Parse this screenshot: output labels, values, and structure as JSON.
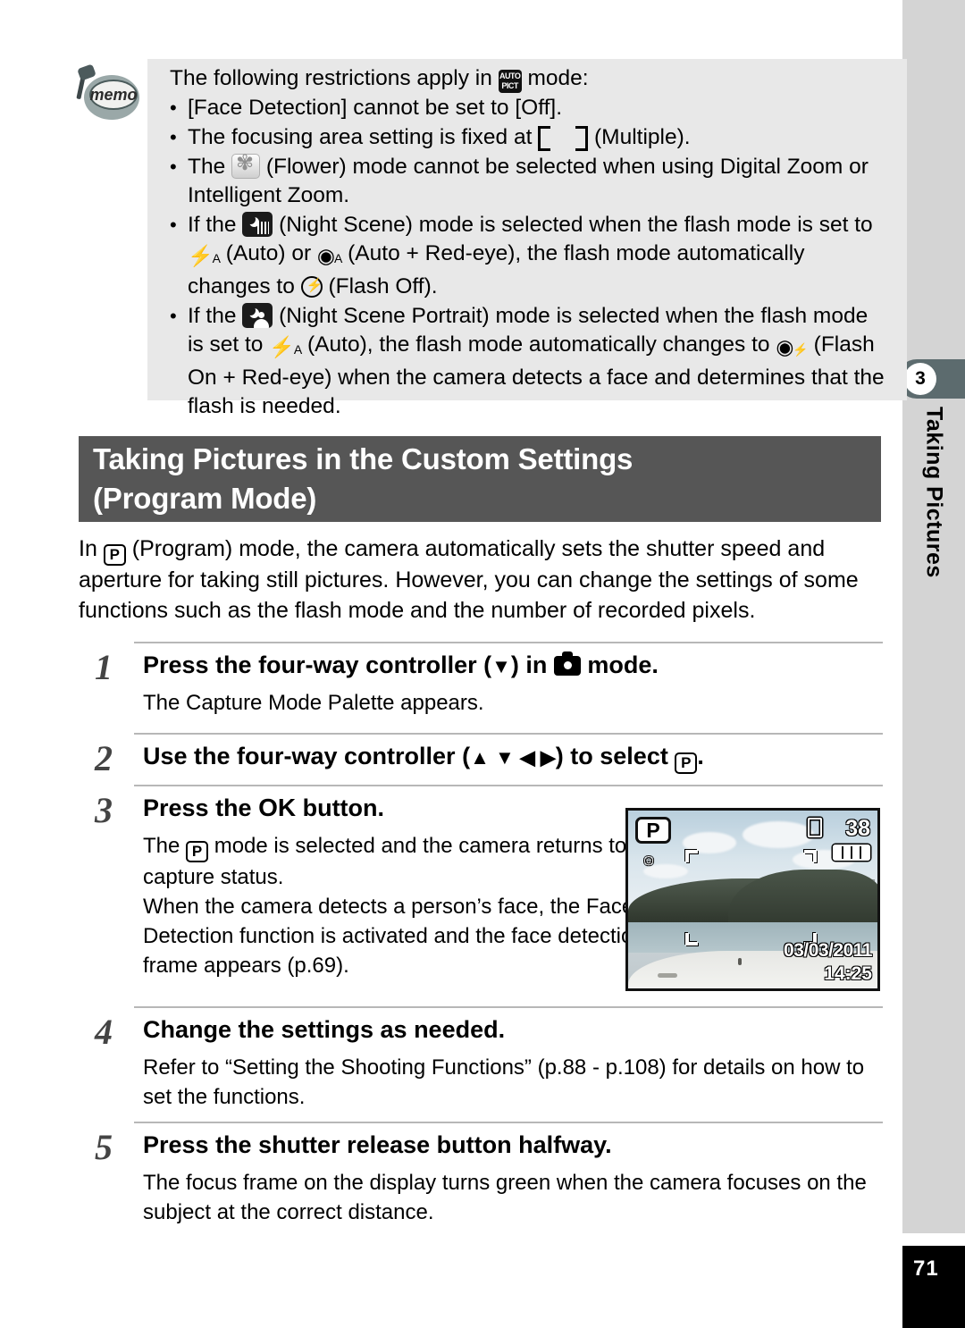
{
  "sidebar": {
    "chapter_number": "3",
    "chapter_label": "Taking Pictures",
    "page_number": "71"
  },
  "memo": {
    "icon_label": "memo",
    "intro_pre": "The following restrictions apply in ",
    "intro_post": " mode:",
    "bullets": [
      {
        "id": "face-detection",
        "segments": [
          {
            "type": "text",
            "value": "[Face Detection] cannot be set to [Off]."
          }
        ]
      },
      {
        "id": "focusing-area",
        "segments": [
          {
            "type": "text",
            "value": "The focusing area setting is fixed at "
          },
          {
            "type": "icon",
            "value": "multiple-focus-frame-icon"
          },
          {
            "type": "text",
            "value": " (Multiple)."
          }
        ]
      },
      {
        "id": "flower-mode",
        "segments": [
          {
            "type": "text",
            "value": "The "
          },
          {
            "type": "icon",
            "value": "flower-mode-icon"
          },
          {
            "type": "text",
            "value": " (Flower) mode cannot be selected when using Digital Zoom or Intelligent Zoom."
          }
        ]
      },
      {
        "id": "night-scene",
        "segments": [
          {
            "type": "text",
            "value": "If the "
          },
          {
            "type": "icon",
            "value": "night-scene-mode-icon"
          },
          {
            "type": "text",
            "value": " (Night Scene) mode is selected when the flash mode is set to "
          },
          {
            "type": "icon",
            "value": "flash-auto-icon"
          },
          {
            "type": "text",
            "value": " (Auto) or "
          },
          {
            "type": "icon",
            "value": "flash-auto-redeye-icon"
          },
          {
            "type": "text",
            "value": " (Auto + Red-eye), the flash mode automatically changes to "
          },
          {
            "type": "icon",
            "value": "flash-off-icon"
          },
          {
            "type": "text",
            "value": " (Flash Off)."
          }
        ]
      },
      {
        "id": "night-scene-portrait",
        "segments": [
          {
            "type": "text",
            "value": "If the "
          },
          {
            "type": "icon",
            "value": "night-scene-portrait-mode-icon"
          },
          {
            "type": "text",
            "value": " (Night Scene Portrait) mode is selected when the flash mode is set to "
          },
          {
            "type": "icon",
            "value": "flash-auto-icon"
          },
          {
            "type": "text",
            "value": " (Auto), the flash mode automatically changes to "
          },
          {
            "type": "icon",
            "value": "flash-on-redeye-icon"
          },
          {
            "type": "text",
            "value": " (Flash On + Red-eye) when the camera detects a face and determines that the flash is needed."
          }
        ]
      }
    ]
  },
  "section": {
    "title_line1": "Taking Pictures in the Custom Settings",
    "title_line2": "(Program Mode)"
  },
  "intro": {
    "pre": "In ",
    "post": " (Program) mode, the camera automatically sets the shutter speed and aperture for taking still pictures. However, you can change the settings of some functions such as the flash mode and the number of recorded pixels."
  },
  "steps": [
    {
      "number": "1",
      "heading_pre": "Press the four-way controller (",
      "heading_arrow": "▼",
      "heading_mid": ") in ",
      "heading_post": " mode.",
      "body": "The Capture Mode Palette appears."
    },
    {
      "number": "2",
      "heading_pre": "Use the four-way controller (",
      "heading_arrow": "▲ ▼ ◀ ▶",
      "heading_mid": ") to select ",
      "heading_post": ".",
      "body": ""
    },
    {
      "number": "3",
      "heading_pre": "Press the ",
      "heading_ok": "OK",
      "heading_post": " button.",
      "body_line1_pre": "The ",
      "body_line1_post": " mode is selected and the camera returns to capture status.",
      "body_line2": "When the camera detects a person’s face, the Face Detection function is activated and the face detection frame appears (p.69)."
    },
    {
      "number": "4",
      "heading": "Change the settings as needed.",
      "body": "Refer to “Setting the Shooting Functions” (p.88 - p.108) for details on how to set the functions."
    },
    {
      "number": "5",
      "heading": "Press the shutter release button halfway.",
      "body": "The focus frame on the display turns green when the camera focuses on the subject at the correct distance."
    }
  ],
  "lcd": {
    "mode_badge": "P",
    "face_detection_icon": "face-detection-icon",
    "card_icon": "memory-card-icon",
    "remaining_shots": "38",
    "battery_icon": "battery-full-icon",
    "date": "03/03/2011",
    "time": "14:25"
  },
  "icons": {
    "auto_pict_top": "AUTO",
    "auto_pict_bottom": "PICT"
  },
  "colors": {
    "memo_bg": "#e8e8e8",
    "section_bar": "#565656",
    "rail_bg": "#d4d4d4",
    "chapter_tab": "#5c6b6e",
    "rule": "#b7b7b7"
  }
}
